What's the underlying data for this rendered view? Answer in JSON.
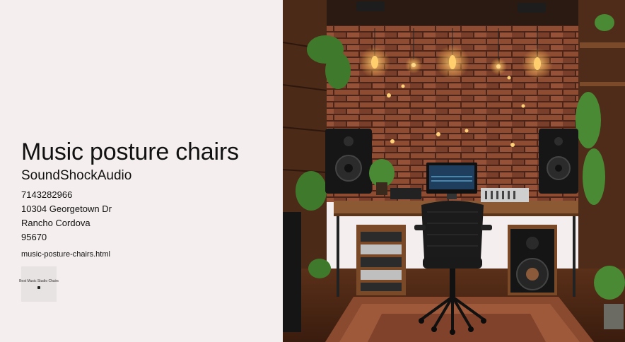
{
  "heading": "Music posture chairs",
  "business": {
    "name": "SoundShockAudio",
    "phone": "7143282966",
    "street": "10304 Georgetown Dr",
    "city": "Rancho Cordova",
    "zip": "95670"
  },
  "link": {
    "label": "music-posture-chairs.html"
  },
  "thumbnail": {
    "caption": "Best Music Studio Chairs"
  },
  "colors": {
    "page_bg": "#f4efee",
    "brick": "#8a4a33",
    "wood": "#6b3e22"
  }
}
